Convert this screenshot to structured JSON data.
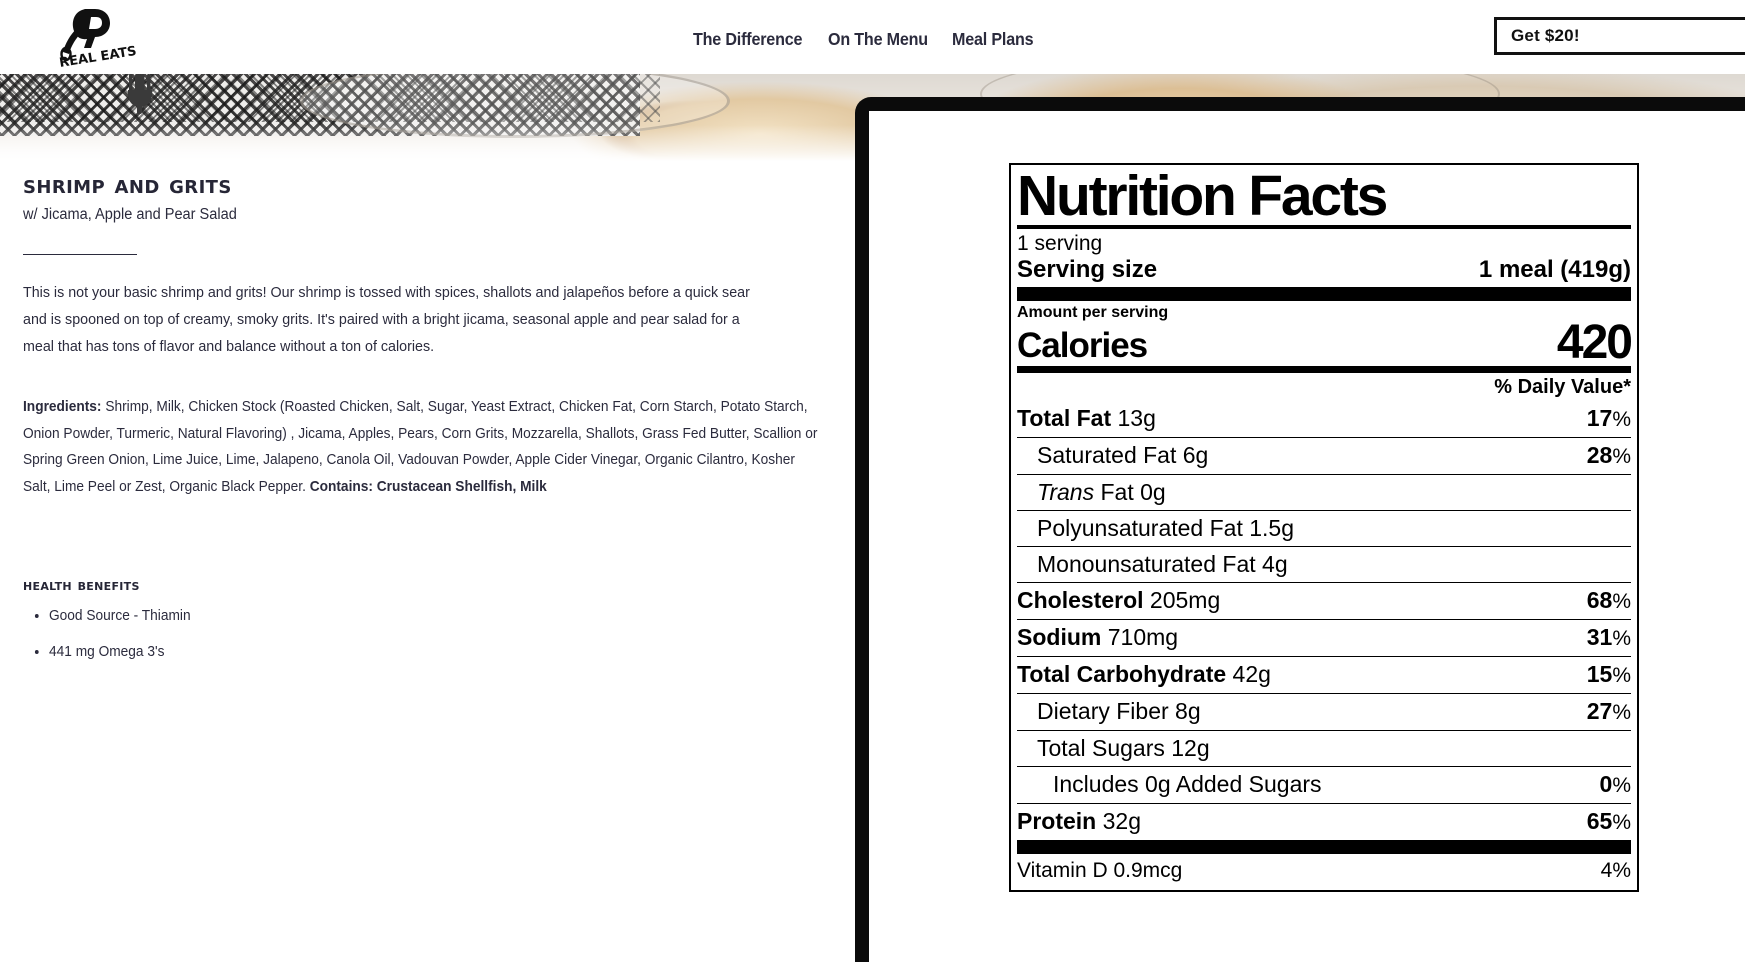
{
  "header": {
    "logo_text": "REAL EATS",
    "logo_icon": "skillet-r-logo",
    "nav": [
      {
        "label": "The Difference"
      },
      {
        "label": "On The Menu"
      },
      {
        "label": "Meal Plans"
      }
    ],
    "cta_label": "Get $20!"
  },
  "dish": {
    "title": "Shrimp and Grits",
    "subtitle": "w/ Jicama, Apple and Pear Salad",
    "description": "This is not your basic shrimp and grits! Our shrimp is tossed with spices, shallots and jalapeños before a quick sear and is spooned on top of creamy, smoky grits. It's paired with a bright jicama, seasonal apple and pear salad for a meal that has tons of flavor and balance without a ton of calories.",
    "ingredients_label": "Ingredients:",
    "ingredients_text": " Shrimp, Milk, Chicken Stock (Roasted Chicken, Salt, Sugar, Yeast Extract, Chicken Fat, Corn Starch, Potato Starch, Onion Powder, Turmeric, Natural Flavoring) , Jicama, Apples, Pears, Corn Grits, Mozzarella, Shallots, Grass Fed Butter, Scallion or Spring Green Onion, Lime Juice, Lime, Jalapeno, Canola Oil, Vadouvan Powder, Apple Cider Vinegar, Organic Cilantro, Kosher Salt, Lime Peel or Zest, Organic Black Pepper. ",
    "contains_label": "Contains: Crustacean Shellfish, Milk"
  },
  "benefits": {
    "title": "Health Benefits",
    "items": [
      {
        "label": "Good Source - Thiamin"
      },
      {
        "label": "441 mg Omega 3's"
      }
    ]
  },
  "nutrition": {
    "title": "Nutrition Facts",
    "servings": "1 serving",
    "serving_size_label": "Serving size",
    "serving_size_value": "1 meal (419g)",
    "amount_per_serving": "Amount per serving",
    "calories_label": "Calories",
    "calories_value": "420",
    "daily_value_header": "% Daily Value*",
    "rows": [
      {
        "name": "Total Fat",
        "bold": true,
        "indent": 0,
        "amount": "13g",
        "dv": "17"
      },
      {
        "name": "Saturated Fat",
        "bold": false,
        "indent": 1,
        "amount": "6g",
        "dv": "28"
      },
      {
        "name": "Trans Fat",
        "bold": false,
        "indent": 1,
        "amount": "0g",
        "dv": "",
        "italic_first": "Trans"
      },
      {
        "name": "Polyunsaturated Fat",
        "bold": false,
        "indent": 1,
        "amount": "1.5g",
        "dv": ""
      },
      {
        "name": "Monounsaturated Fat",
        "bold": false,
        "indent": 1,
        "amount": "4g",
        "dv": ""
      },
      {
        "name": "Cholesterol",
        "bold": true,
        "indent": 0,
        "amount": "205mg",
        "dv": "68"
      },
      {
        "name": "Sodium",
        "bold": true,
        "indent": 0,
        "amount": "710mg",
        "dv": "31"
      },
      {
        "name": "Total Carbohydrate",
        "bold": true,
        "indent": 0,
        "amount": "42g",
        "dv": "15"
      },
      {
        "name": "Dietary Fiber",
        "bold": false,
        "indent": 1,
        "amount": "8g",
        "dv": "27"
      },
      {
        "name": "Total Sugars",
        "bold": false,
        "indent": 1,
        "amount": "12g",
        "dv": ""
      },
      {
        "name": "Includes 0g Added Sugars",
        "bold": false,
        "indent": 2,
        "amount": "",
        "dv": "0"
      },
      {
        "name": "Protein",
        "bold": true,
        "indent": 0,
        "amount": "32g",
        "dv": "65"
      }
    ],
    "vitamins": [
      {
        "name": "Vitamin D  0.9mcg",
        "dv": "4%"
      }
    ]
  },
  "colors": {
    "text": "#2b2b3d",
    "label_border": "#000000",
    "frame": "#0b0b0b",
    "page_bg": "#ffffff"
  }
}
